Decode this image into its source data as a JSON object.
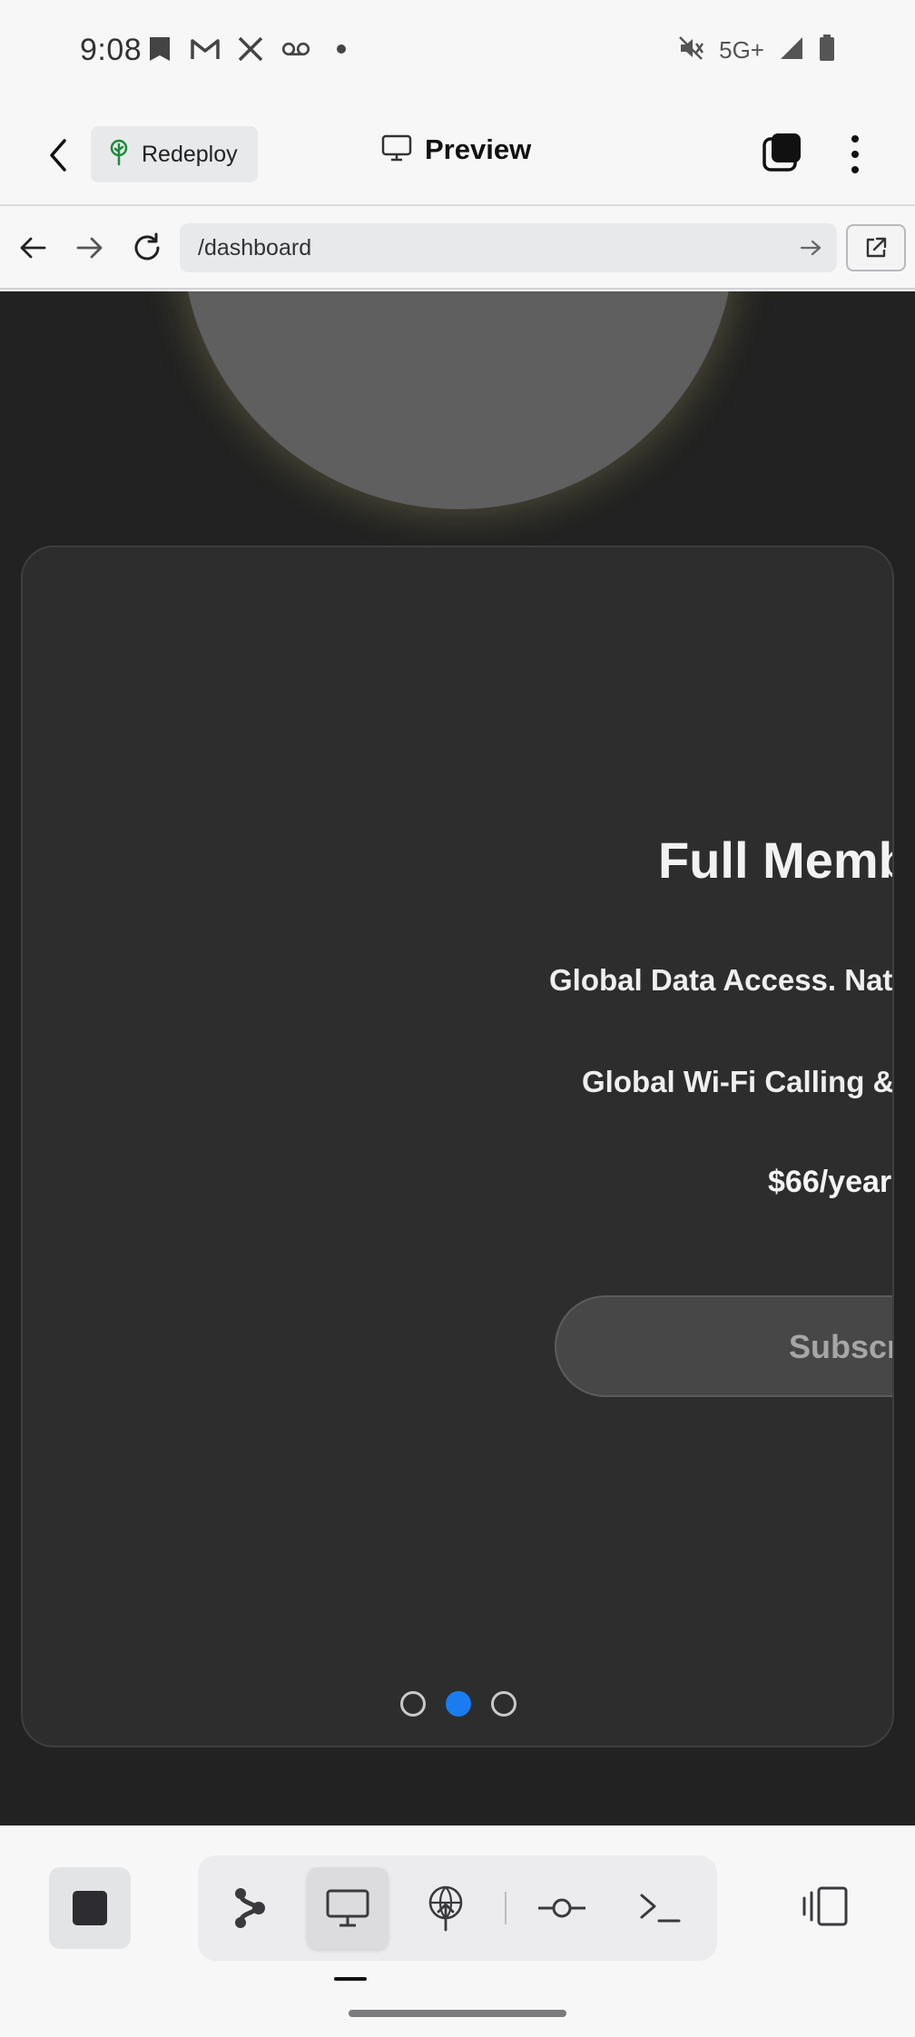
{
  "status_bar": {
    "time": "9:08",
    "network": "5G+",
    "left_icons": [
      "bookmark-icon",
      "gmail-icon",
      "x-icon",
      "voicemail-icon",
      "dot-icon"
    ],
    "right_icons": [
      "mute-icon",
      "signal-icon",
      "battery-icon"
    ]
  },
  "header": {
    "back_icon": "chevron-left-icon",
    "redeploy_label": "Redeploy",
    "redeploy_icon": "tree-icon",
    "redeploy_icon_color": "#1f8a3b",
    "preview_label": "Preview",
    "preview_icon": "monitor-icon",
    "tabs_icon": "tabs-icon",
    "more_icon": "more-vertical-icon"
  },
  "browser": {
    "back_icon": "arrow-left-icon",
    "forward_icon": "arrow-right-icon",
    "reload_icon": "reload-icon",
    "url": "/dashboard",
    "go_icon": "arrow-right-icon",
    "open_external_icon": "external-link-icon"
  },
  "page": {
    "background_color": "#222222",
    "card_color": "#2d2d2d",
    "plan": {
      "title": "Full Membe",
      "line1": "Global Data Access. Nati",
      "line2": "Global Wi-Fi Calling & S",
      "price": "$66/year",
      "subscribe_label": "Subscribe"
    },
    "carousel": {
      "slide_count": 3,
      "active_index": 1,
      "active_color": "#1a7cf0"
    }
  },
  "bottom_toolbar": {
    "stop_icon": "stop-icon",
    "tools": [
      {
        "icon": "graph-icon",
        "active": false
      },
      {
        "icon": "monitor-icon",
        "active": true
      },
      {
        "icon": "deploy-icon",
        "active": false
      },
      {
        "icon": "commit-icon",
        "active": false
      },
      {
        "icon": "terminal-icon",
        "active": false
      }
    ],
    "split_icon": "split-view-icon"
  }
}
